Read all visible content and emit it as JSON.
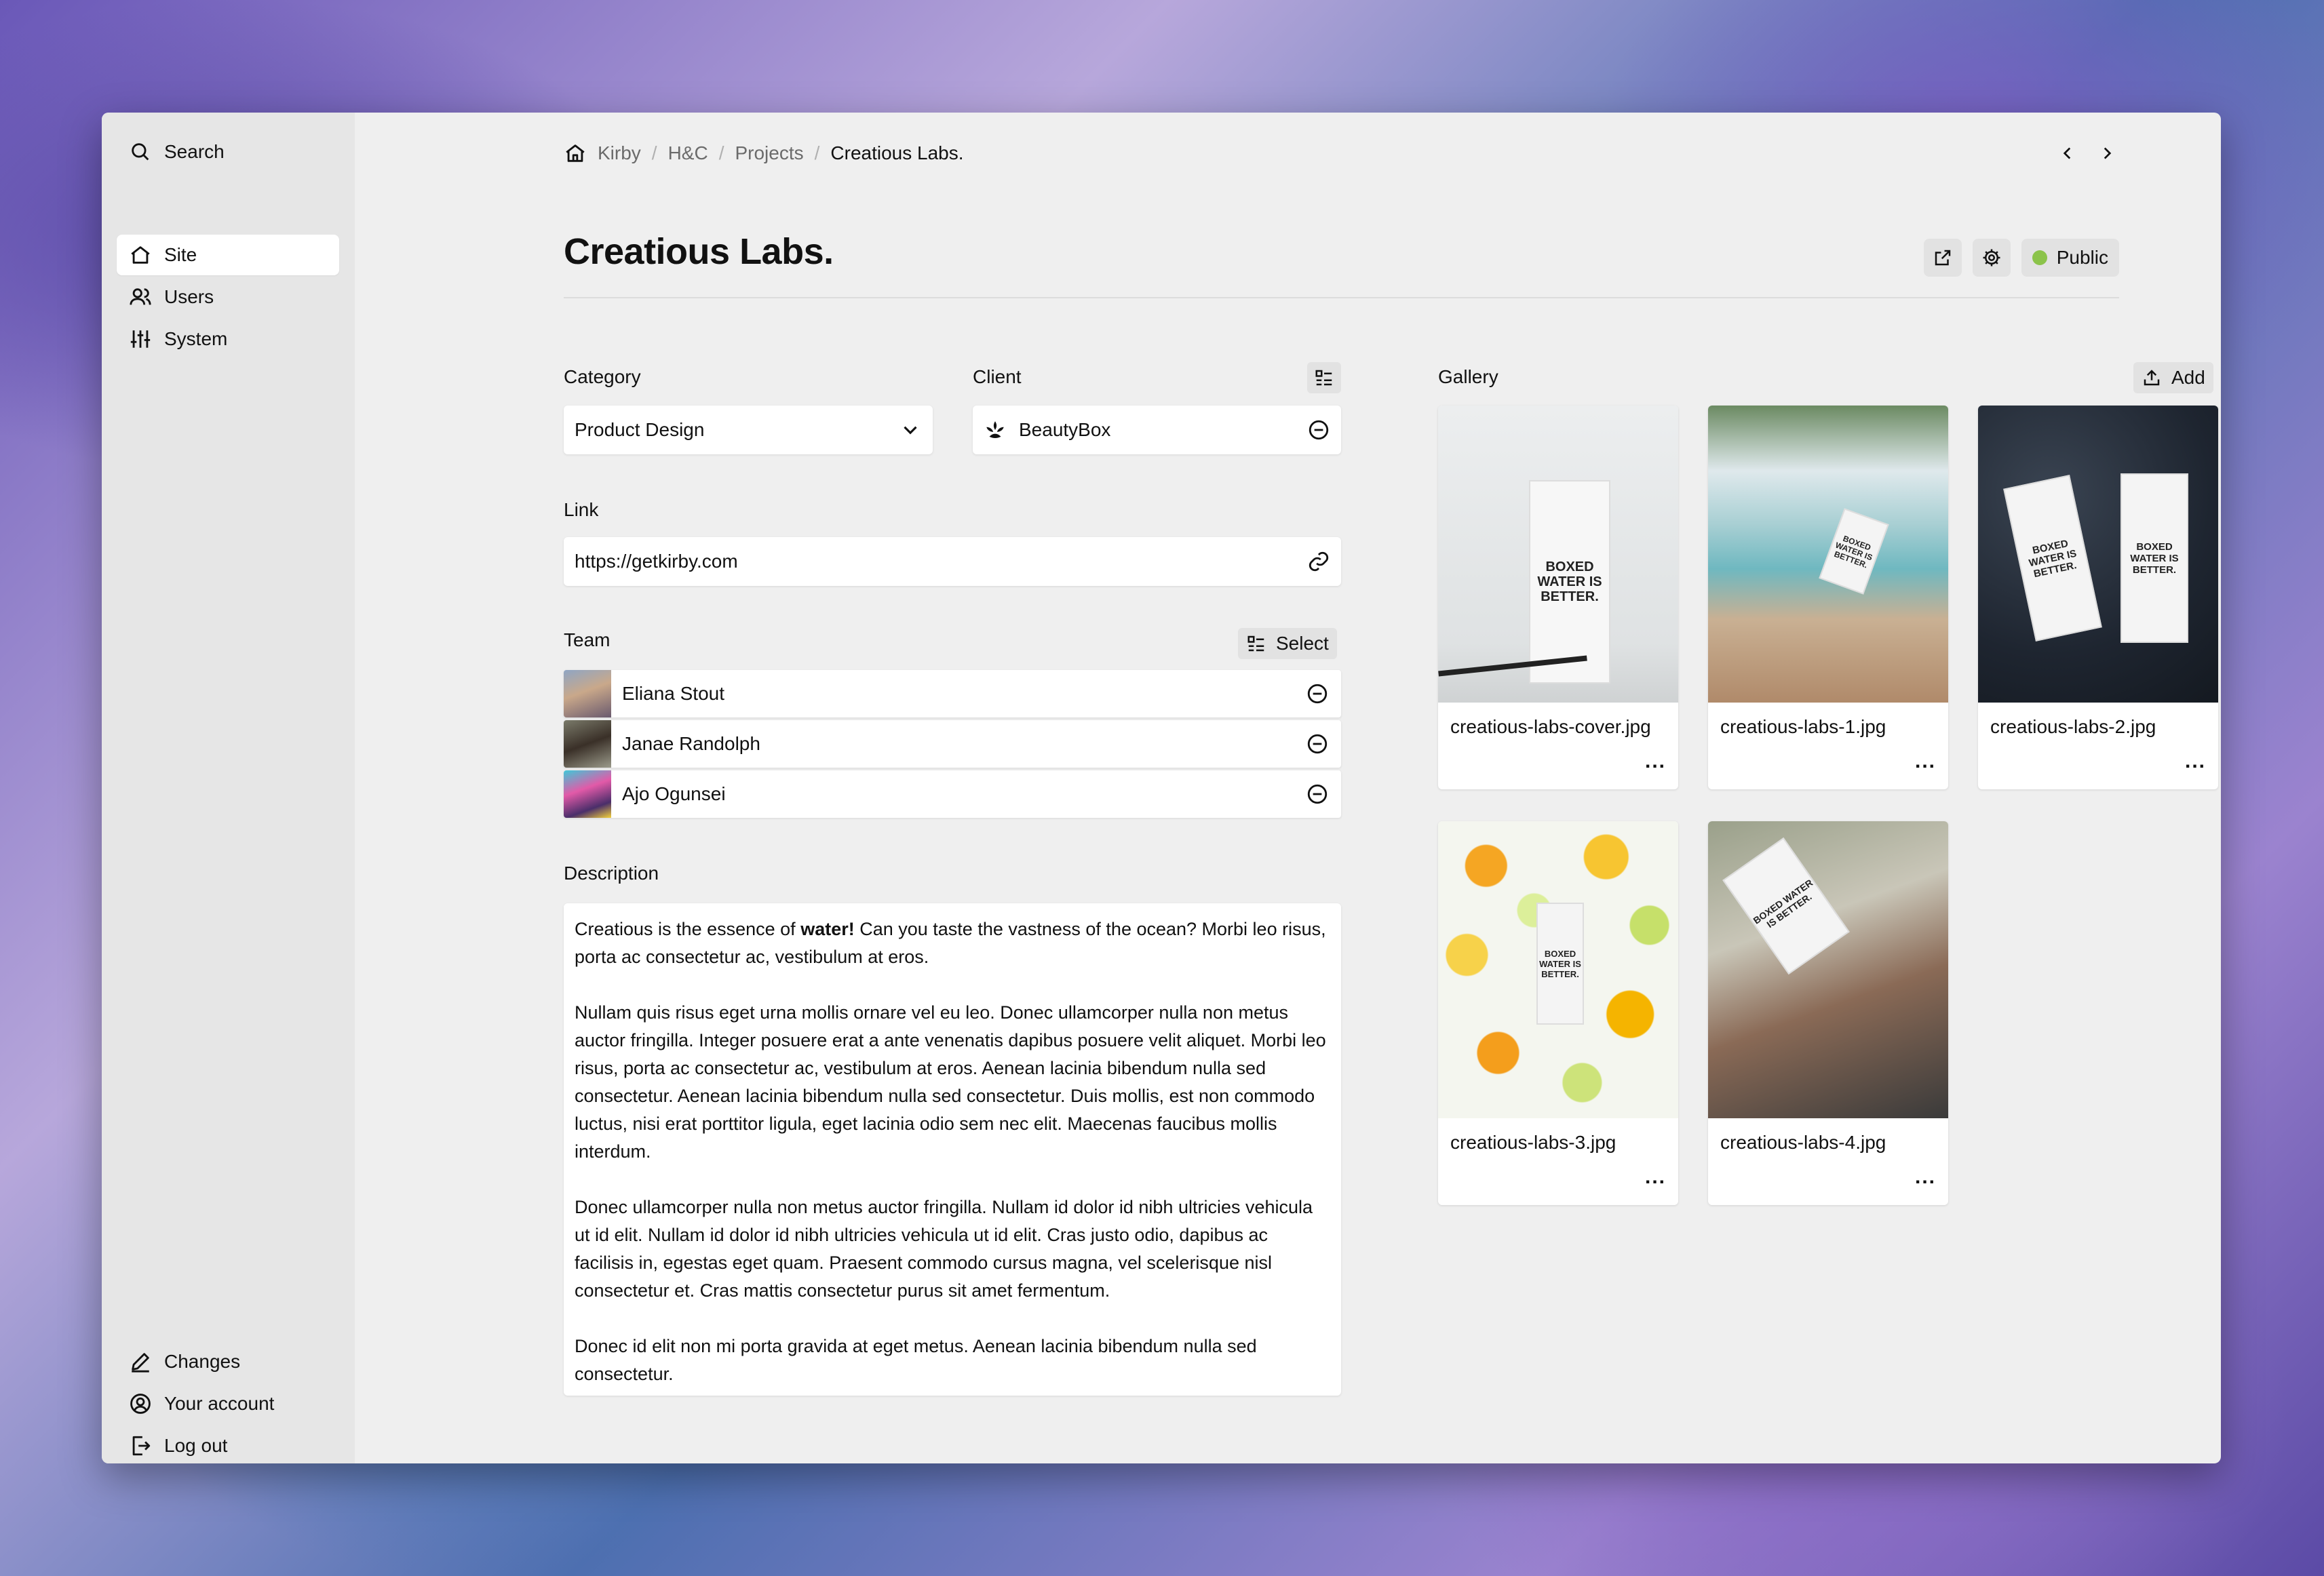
{
  "sidebar": {
    "search": "Search",
    "nav": [
      {
        "label": "Site",
        "icon": "home-icon",
        "active": true
      },
      {
        "label": "Users",
        "icon": "users-icon"
      },
      {
        "label": "System",
        "icon": "sliders-icon"
      }
    ],
    "bottom": [
      {
        "label": "Changes",
        "icon": "pen-icon"
      },
      {
        "label": "Your account",
        "icon": "account-icon"
      },
      {
        "label": "Log out",
        "icon": "logout-icon"
      }
    ]
  },
  "breadcrumb": [
    "Kirby",
    "H&C",
    "Projects",
    "Creatious Labs."
  ],
  "page": {
    "title": "Creatious Labs.",
    "status": "Public",
    "status_color": "#8bc34a"
  },
  "fields": {
    "category": {
      "label": "Category",
      "value": "Product Design"
    },
    "client": {
      "label": "Client",
      "value": "BeautyBox"
    },
    "link": {
      "label": "Link",
      "value": "https://getkirby.com"
    },
    "team": {
      "label": "Team",
      "select_label": "Select",
      "members": [
        "Eliana Stout",
        "Janae Randolph",
        "Ajo Ogunsei"
      ]
    },
    "description": {
      "label": "Description",
      "p1_a": "Creatious is the essence of ",
      "p1_bold": "water!",
      "p1_b": " Can you taste the vastness of the ocean? Morbi leo risus, porta ac consectetur ac, vestibulum at eros.",
      "p2": "Nullam quis risus eget urna mollis ornare vel eu leo. Donec ullamcorper nulla non metus auctor fringilla. Integer posuere erat a ante venenatis dapibus posuere velit aliquet. Morbi leo risus, porta ac consectetur ac, vestibulum at eros.  Aenean lacinia bibendum nulla sed consectetur. Aenean lacinia bibendum nulla sed consectetur. Duis mollis, est non commodo luctus, nisi erat porttitor ligula, eget lacinia odio sem nec elit. Maecenas faucibus mollis interdum.",
      "p3": "Donec ullamcorper nulla non metus auctor fringilla.  Nullam id dolor id nibh ultricies vehicula ut id elit. Nullam id dolor id nibh ultricies vehicula ut id elit. Cras justo odio, dapibus ac facilisis in, egestas eget quam. Praesent commodo cursus magna, vel scelerisque nisl consectetur et. Cras mattis consectetur purus sit amet fermentum.",
      "p4": "Donec id elit non mi porta gravida at eget metus. Aenean lacinia bibendum nulla sed consectetur."
    }
  },
  "gallery": {
    "label": "Gallery",
    "add_label": "Add",
    "more": "...",
    "carton_text": "BOXED WATER IS BETTER.",
    "files": [
      "creatious-labs-cover.jpg",
      "creatious-labs-1.jpg",
      "creatious-labs-2.jpg",
      "creatious-labs-3.jpg",
      "creatious-labs-4.jpg"
    ]
  }
}
